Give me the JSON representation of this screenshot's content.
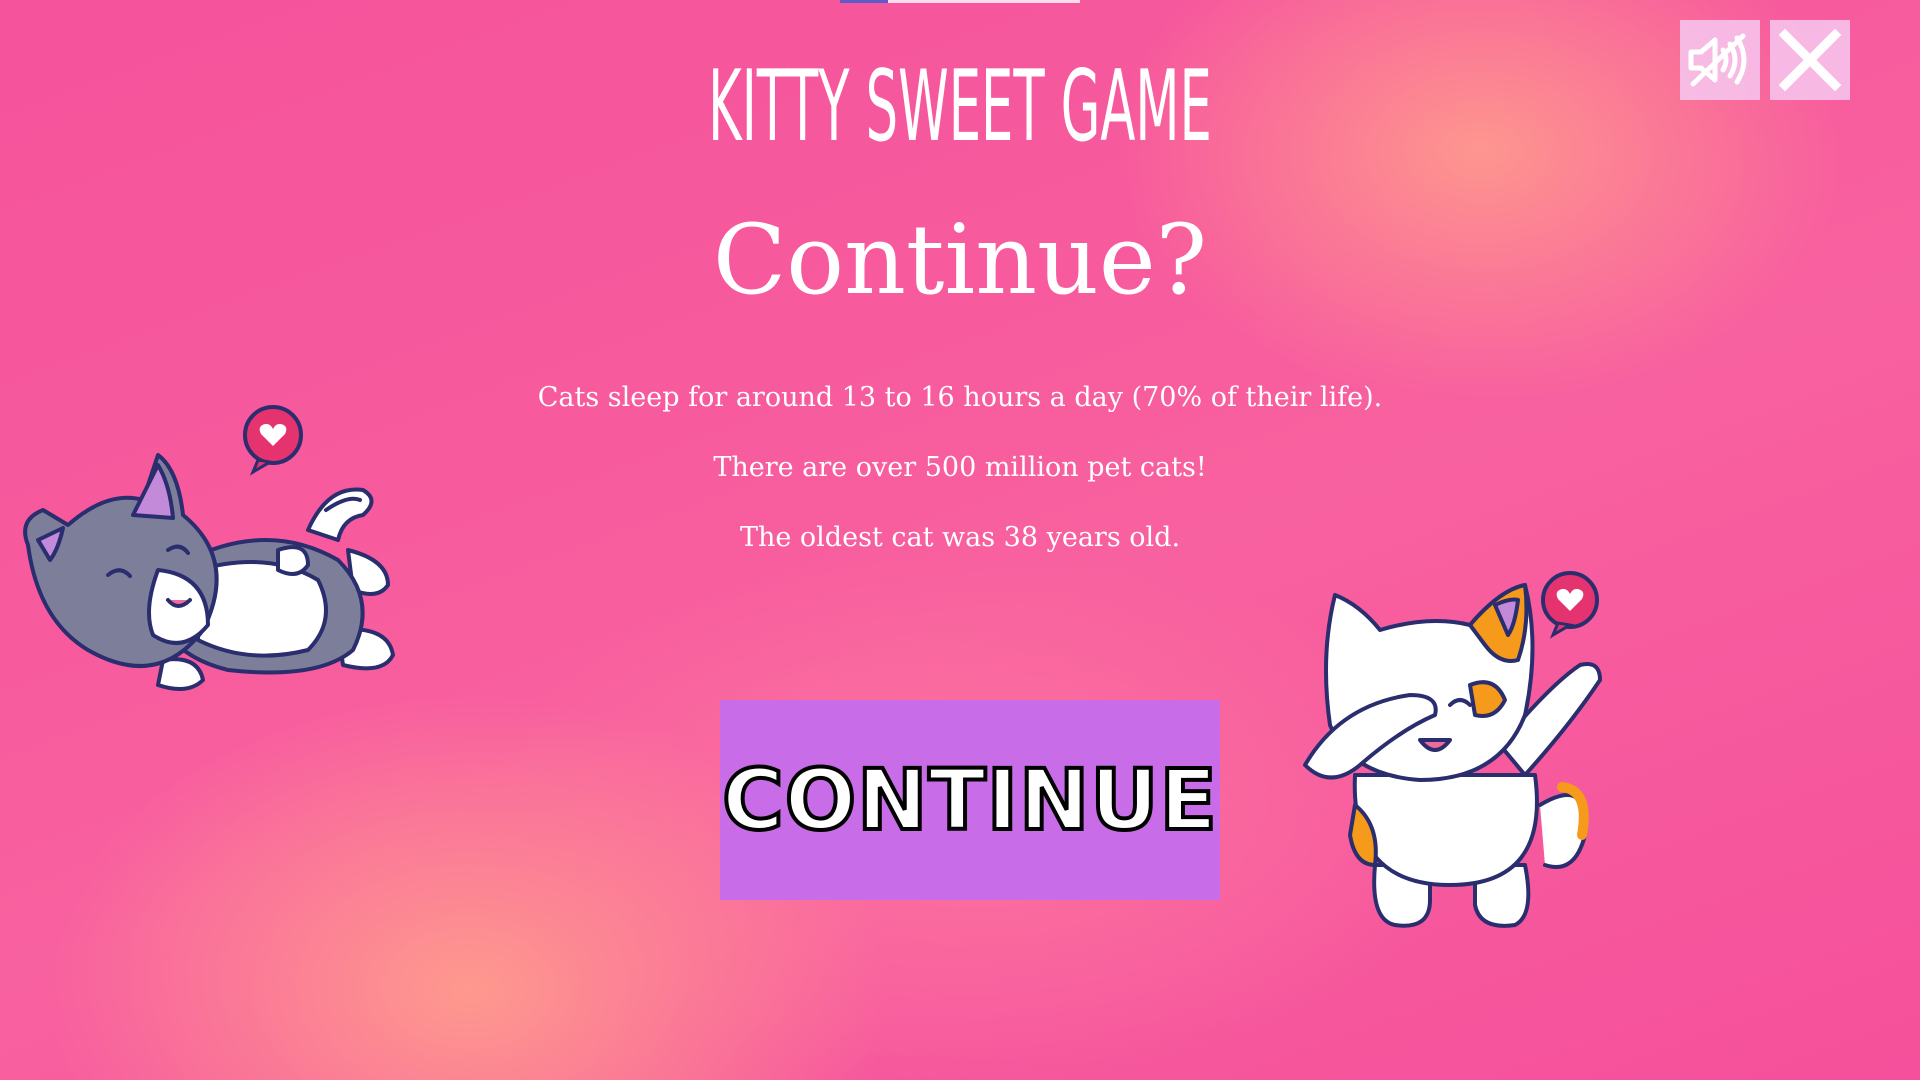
{
  "header": {
    "game_title": "KITTY SWEET GAME",
    "heading": "Continue?"
  },
  "facts": [
    "Cats sleep for around 13 to 16 hours a day (70% of their life).",
    "There are over 500 million pet cats!",
    "The oldest cat was 38 years old."
  ],
  "buttons": {
    "continue_label": "CONTINUE",
    "mute_icon": "speaker-muted-icon",
    "close_icon": "close-x-icon"
  },
  "decorations": {
    "left_cat": "lying-gray-cat-illustration",
    "right_cat": "dabbing-calico-cat-illustration",
    "heart_icon": "heart-speech-bubble-icon"
  },
  "colors": {
    "background": "#f5539c",
    "button": "#c96ce8",
    "icon_button": "#f7c8f0",
    "text": "#ffffff"
  }
}
